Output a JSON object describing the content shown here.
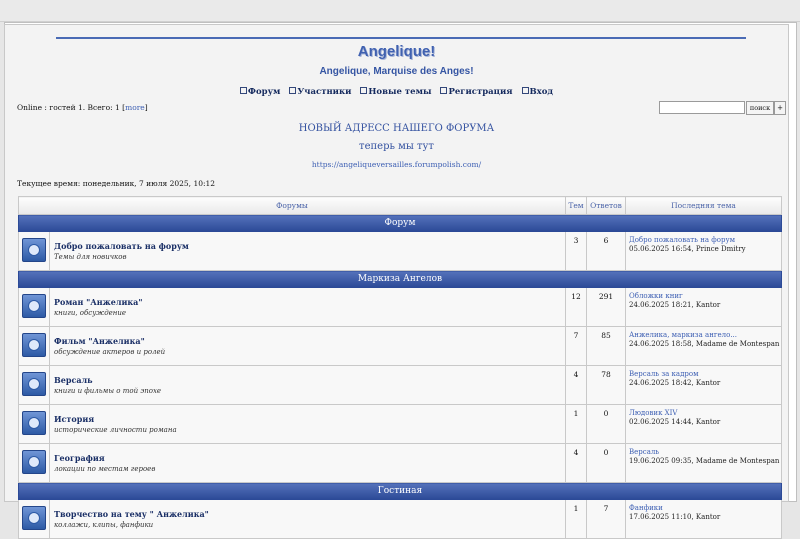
{
  "site": {
    "title": "Angelique!",
    "subtitle": "Angelique, Marquise des Anges!"
  },
  "nav": [
    {
      "label": "Форум"
    },
    {
      "label": "Участники"
    },
    {
      "label": "Новые темы"
    },
    {
      "label": "Регистрация"
    },
    {
      "label": "Вход"
    }
  ],
  "online": {
    "text": "Online : гостей 1. Всего: 1 [",
    "more": "more",
    "close": "]"
  },
  "search": {
    "button": "поиск",
    "plus": "+",
    "value": ""
  },
  "announcement": {
    "line1": "НОВЫЙ АДРЕСС НАШЕГО ФОРУМА",
    "line2": "теперь мы тут",
    "link": "https://angeliqueversailles.forumpolish.com/"
  },
  "current_time": "Текущее время: понедельник, 7 июля 2025, 10:12",
  "table_headers": {
    "forums": "Форумы",
    "topics": "Тем",
    "replies": "Ответов",
    "last": "Последняя тема"
  },
  "categories": [
    {
      "name": "Форум",
      "forums": [
        {
          "name": "Добро пожаловать на форум",
          "desc": "Темы для новичков",
          "topics": "3",
          "replies": "6",
          "last_title": "Добро пожаловать на форум",
          "last_meta": "05.06.2025 16:54, Prince Dmitry"
        }
      ]
    },
    {
      "name": "Маркиза Ангелов",
      "forums": [
        {
          "name": "Роман \"Анжелика\"",
          "desc": "книги, обсуждение",
          "topics": "12",
          "replies": "291",
          "last_title": "Обложки книг",
          "last_meta": "24.06.2025 18:21, Kantor"
        },
        {
          "name": "Фильм \"Анжелика\"",
          "desc": "обсуждение актеров и ролей",
          "topics": "7",
          "replies": "85",
          "last_title": "Анжелика, маркиза ангело...",
          "last_meta": "24.06.2025 18:58, Madame de Montespan"
        },
        {
          "name": "Версаль",
          "desc": "книги и фильмы о той эпохе",
          "topics": "4",
          "replies": "78",
          "last_title": "Версаль за кадром",
          "last_meta": "24.06.2025 18:42, Kantor"
        },
        {
          "name": "История",
          "desc": "исторические личности романа",
          "topics": "1",
          "replies": "0",
          "last_title": "Людовик XIV",
          "last_meta": "02.06.2025 14:44, Kantor"
        },
        {
          "name": "География",
          "desc": "локации по местам героев",
          "topics": "4",
          "replies": "0",
          "last_title": "Версаль",
          "last_meta": "19.06.2025 09:35, Madame de Montespan"
        }
      ]
    },
    {
      "name": "Гостиная",
      "forums": [
        {
          "name": "Творчество на тему \" Анжелика\"",
          "desc": "коллажи, клипы, фанфики",
          "topics": "1",
          "replies": "7",
          "last_title": "Фанфики",
          "last_meta": "17.06.2025 11:10, Kantor"
        }
      ]
    }
  ]
}
